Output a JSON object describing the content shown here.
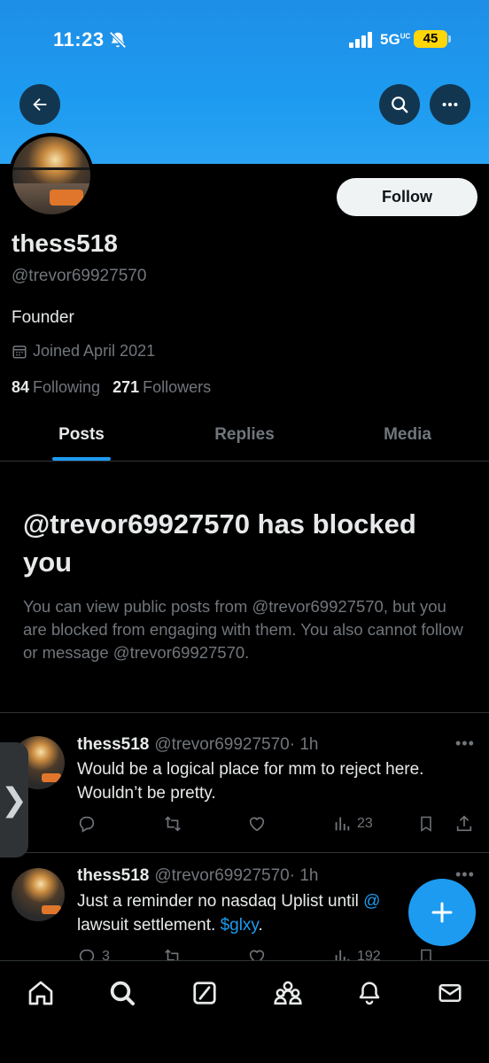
{
  "status_bar": {
    "time": "11:23",
    "network": "5G",
    "network_sup": "UC",
    "battery": "45"
  },
  "header": {
    "icons": [
      "back-arrow-icon",
      "search-icon",
      "more-icon"
    ],
    "banner_color": "#1d9bf0"
  },
  "profile": {
    "display_name": "thess518",
    "handle": "@trevor69927570",
    "bio": "Founder",
    "joined": "Joined April 2021",
    "following_count": "84",
    "following_label": "Following",
    "followers_count": "271",
    "followers_label": "Followers",
    "follow_label": "Follow"
  },
  "tabs": [
    {
      "label": "Posts",
      "active": true
    },
    {
      "label": "Replies",
      "active": false
    },
    {
      "label": "Media",
      "active": false
    }
  ],
  "blocked": {
    "title": "@trevor69927570 has blocked you",
    "description": "You can view public posts from @trevor69927570, but you are blocked from engaging with them. You also cannot follow or message @trevor69927570."
  },
  "posts": [
    {
      "name": "thess518",
      "handle": "@trevor69927570",
      "time": "· 1h",
      "text": "Would be a logical place for mm to reject here. Wouldn’t be pretty.",
      "views": "23"
    },
    {
      "name": "thess518",
      "handle": "@trevor69927570",
      "time": "· 1h",
      "text_a": "Just a reminder no nasdaq Uplist until ",
      "text_mention": "@",
      "text_b": "lawsuit settlement. ",
      "text_cashtag": "$glxy",
      "text_c": ".",
      "replies": "3",
      "views": "192"
    }
  ],
  "colors": {
    "accent": "#1d9bf0",
    "background": "#000000",
    "muted": "#71767b",
    "battery": "#ffd60a"
  }
}
